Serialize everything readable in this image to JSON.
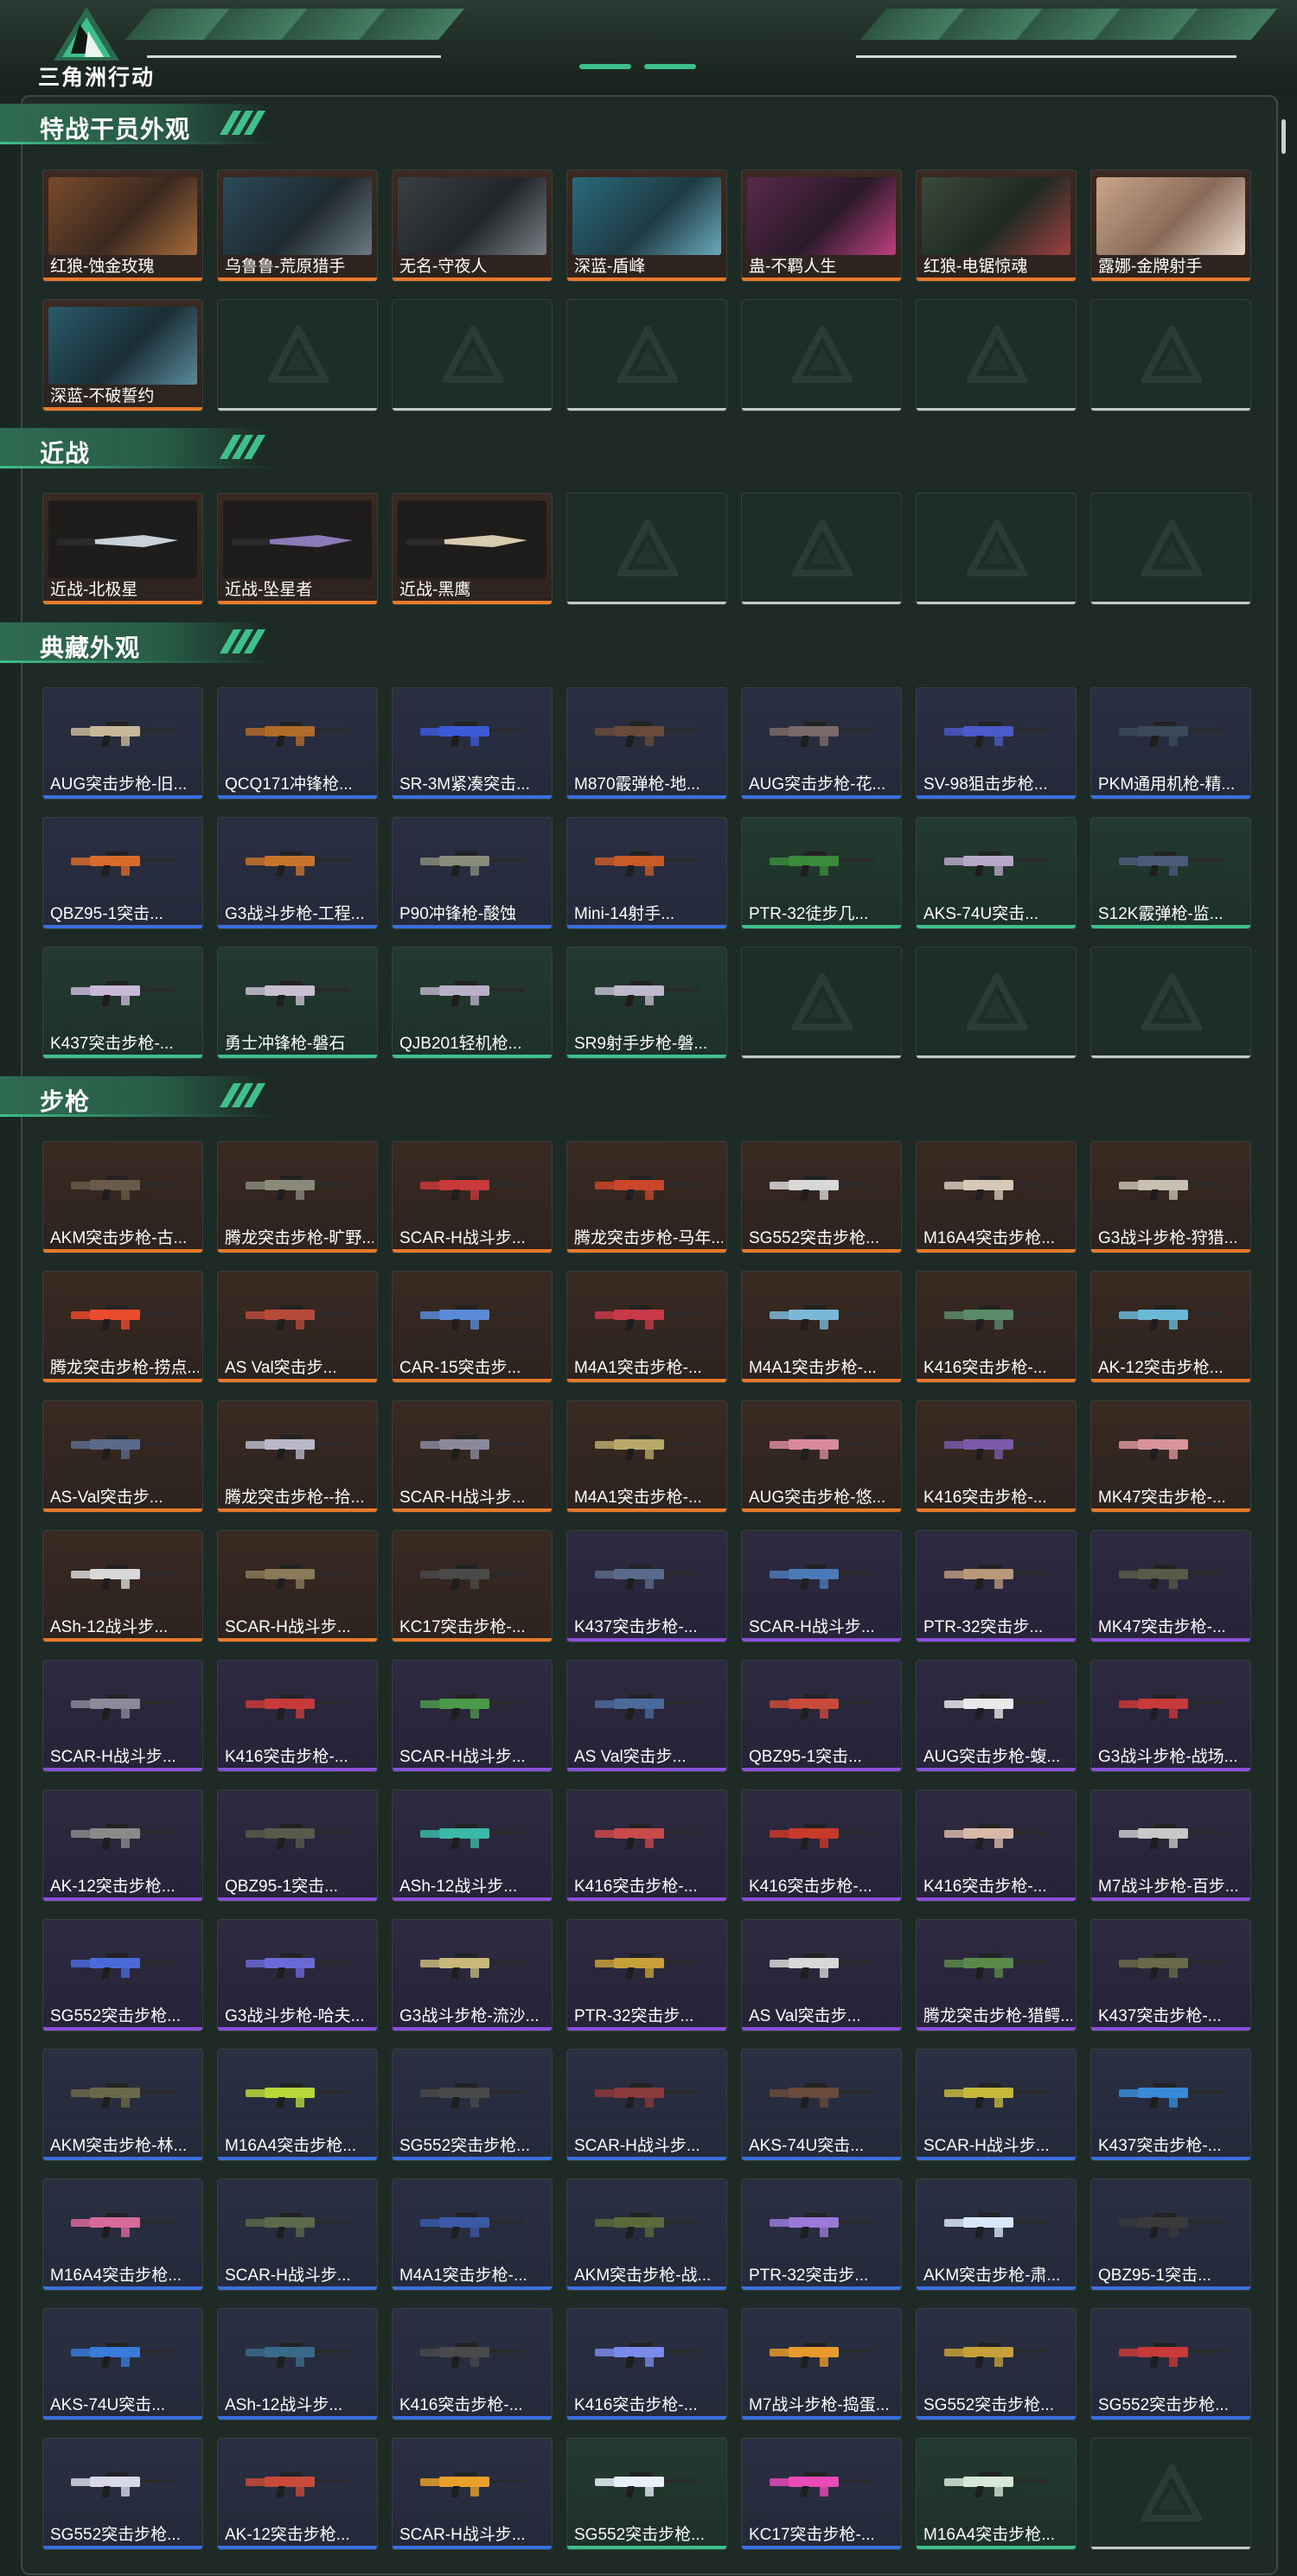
{
  "app": {
    "title": "三角洲行动"
  },
  "colors": {
    "accent": "#3fbf8c",
    "orange": "#e8782a",
    "blue": "#3a6fe0",
    "purple": "#8a4fd8",
    "green": "#3fbf8c"
  },
  "sections": [
    {
      "title": "特战干员外观",
      "kind": "operator",
      "items": [
        {
          "label": "红狼-蚀金玫瑰",
          "rarity": "orange"
        },
        {
          "label": "乌鲁鲁-荒原猎手",
          "rarity": "orange"
        },
        {
          "label": "无名-守夜人",
          "rarity": "orange"
        },
        {
          "label": "深蓝-盾峰",
          "rarity": "orange"
        },
        {
          "label": "蛊-不羁人生",
          "rarity": "orange"
        },
        {
          "label": "红狼-电锯惊魂",
          "rarity": "orange"
        },
        {
          "label": "露娜-金牌射手",
          "rarity": "orange"
        },
        {
          "label": "深蓝-不破誓约",
          "rarity": "orange"
        }
      ],
      "empty_slots": 6
    },
    {
      "title": "近战",
      "kind": "melee",
      "items": [
        {
          "label": "近战-北极星",
          "rarity": "orange"
        },
        {
          "label": "近战-坠星者",
          "rarity": "orange"
        },
        {
          "label": "近战-黑鹰",
          "rarity": "orange"
        }
      ],
      "empty_slots": 4
    },
    {
      "title": "典藏外观",
      "kind": "weapon",
      "items": [
        {
          "label": "AUG突击步枪-旧...",
          "rarity": "blue",
          "gun": "#c8b89a"
        },
        {
          "label": "QCQ171冲锋枪...",
          "rarity": "blue",
          "gun": "#b06a2a"
        },
        {
          "label": "SR-3M紧凑突击...",
          "rarity": "blue",
          "gun": "#3a5ad8"
        },
        {
          "label": "M870霰弹枪-地...",
          "rarity": "blue",
          "gun": "#6a4a3a"
        },
        {
          "label": "AUG突击步枪-花...",
          "rarity": "blue",
          "gun": "#7a6a6a"
        },
        {
          "label": "SV-98狙击步枪...",
          "rarity": "blue",
          "gun": "#4a5ac8"
        },
        {
          "label": "PKM通用机枪-精...",
          "rarity": "blue",
          "gun": "#3a4a5a"
        },
        {
          "label": "QBZ95-1突击...",
          "rarity": "blue",
          "gun": "#d86a2a"
        },
        {
          "label": "G3战斗步枪-工程...",
          "rarity": "blue",
          "gun": "#c8742a"
        },
        {
          "label": "P90冲锋枪-酸蚀",
          "rarity": "blue",
          "gun": "#8a8a7a"
        },
        {
          "label": "Mini-14射手...",
          "rarity": "blue",
          "gun": "#c85a2a"
        },
        {
          "label": "PTR-32徒步几...",
          "rarity": "green",
          "gun": "#3a8a3a"
        },
        {
          "label": "AKS-74U突击...",
          "rarity": "green",
          "gun": "#b8a8c8"
        },
        {
          "label": "S12K霰弹枪-监...",
          "rarity": "green",
          "gun": "#4a5a7a"
        },
        {
          "label": "K437突击步枪-...",
          "rarity": "green",
          "gun": "#c8b8d8"
        },
        {
          "label": "勇士冲锋枪-磐石",
          "rarity": "green",
          "gun": "#c8c0d0"
        },
        {
          "label": "QJB201轻机枪...",
          "rarity": "green",
          "gun": "#b8b0c8"
        },
        {
          "label": "SR9射手步枪-磐...",
          "rarity": "green",
          "gun": "#c0b8cc"
        }
      ],
      "empty_slots": 3
    },
    {
      "title": "步枪",
      "kind": "weapon",
      "items": [
        {
          "label": "AKM突击步枪-古...",
          "rarity": "orange",
          "gun": "#6a5a4a"
        },
        {
          "label": "腾龙突击步枪-旷野...",
          "rarity": "orange",
          "gun": "#8a8a7a"
        },
        {
          "label": "SCAR-H战斗步...",
          "rarity": "orange",
          "gun": "#c83a3a"
        },
        {
          "label": "腾龙突击步枪-马年...",
          "rarity": "orange",
          "gun": "#c8462a"
        },
        {
          "label": "SG552突击步枪...",
          "rarity": "orange",
          "gun": "#d8d8d8"
        },
        {
          "label": "M16A4突击步枪...",
          "rarity": "orange",
          "gun": "#d8c8b8"
        },
        {
          "label": "G3战斗步枪-狩猎...",
          "rarity": "orange",
          "gun": "#c8c0b0"
        },
        {
          "label": "腾龙突击步枪-捞点...",
          "rarity": "orange",
          "gun": "#e84a2a"
        },
        {
          "label": "AS Val突击步...",
          "rarity": "orange",
          "gun": "#b84a3a"
        },
        {
          "label": "CAR-15突击步...",
          "rarity": "orange",
          "gun": "#5a8ad8"
        },
        {
          "label": "M4A1突击步枪-...",
          "rarity": "orange",
          "gun": "#c83a4a"
        },
        {
          "label": "M4A1突击步枪-...",
          "rarity": "orange",
          "gun": "#7ab8d8"
        },
        {
          "label": "K416突击步枪-...",
          "rarity": "orange",
          "gun": "#5a8a6a"
        },
        {
          "label": "AK-12突击步枪...",
          "rarity": "orange",
          "gun": "#6ab8d8"
        },
        {
          "label": "AS-Val突击步...",
          "rarity": "orange",
          "gun": "#5a6a8a"
        },
        {
          "label": "腾龙突击步枪--拾...",
          "rarity": "orange",
          "gun": "#b8b8c8"
        },
        {
          "label": "SCAR-H战斗步...",
          "rarity": "orange",
          "gun": "#8a8a9a"
        },
        {
          "label": "M4A1突击步枪-...",
          "rarity": "orange",
          "gun": "#b8a86a"
        },
        {
          "label": "AUG突击步枪-悠...",
          "rarity": "orange",
          "gun": "#d88a9a"
        },
        {
          "label": "K416突击步枪-...",
          "rarity": "orange",
          "gun": "#7a5aa8"
        },
        {
          "label": "MK47突击步枪-...",
          "rarity": "orange",
          "gun": "#d8949a"
        },
        {
          "label": "ASh-12战斗步...",
          "rarity": "orange",
          "gun": "#d8d8d8"
        },
        {
          "label": "SCAR-H战斗步...",
          "rarity": "orange",
          "gun": "#8a7a5a"
        },
        {
          "label": "KC17突击步枪-...",
          "rarity": "orange",
          "gun": "#4a4a4a"
        },
        {
          "label": "K437突击步枪-...",
          "rarity": "purple",
          "gun": "#5a6a8a"
        },
        {
          "label": "SCAR-H战斗步...",
          "rarity": "purple",
          "gun": "#4a7ab8"
        },
        {
          "label": "PTR-32突击步...",
          "rarity": "purple",
          "gun": "#b89a7a"
        },
        {
          "label": "MK47突击步枪-...",
          "rarity": "purple",
          "gun": "#5a5a4a"
        },
        {
          "label": "SCAR-H战斗步...",
          "rarity": "purple",
          "gun": "#8a8a9a"
        },
        {
          "label": "K416突击步枪-...",
          "rarity": "purple",
          "gun": "#c83a3a"
        },
        {
          "label": "SCAR-H战斗步...",
          "rarity": "purple",
          "gun": "#4a9a4a"
        },
        {
          "label": "AS Val突击步...",
          "rarity": "purple",
          "gun": "#4a6a9a"
        },
        {
          "label": "QBZ95-1突击...",
          "rarity": "purple",
          "gun": "#c84a3a"
        },
        {
          "label": "AUG突击步枪-蝮...",
          "rarity": "purple",
          "gun": "#e8e8e8"
        },
        {
          "label": "G3战斗步枪-战场...",
          "rarity": "purple",
          "gun": "#c83a3a"
        },
        {
          "label": "AK-12突击步枪...",
          "rarity": "purple",
          "gun": "#8a8a8a"
        },
        {
          "label": "QBZ95-1突击...",
          "rarity": "purple",
          "gun": "#5a5a4a"
        },
        {
          "label": "ASh-12战斗步...",
          "rarity": "purple",
          "gun": "#3ab8a8"
        },
        {
          "label": "K416突击步枪-...",
          "rarity": "purple",
          "gun": "#c84a4a"
        },
        {
          "label": "K416突击步枪-...",
          "rarity": "purple",
          "gun": "#c83a2a"
        },
        {
          "label": "K416突击步枪-...",
          "rarity": "purple",
          "gun": "#d8b8a8"
        },
        {
          "label": "M7战斗步枪-百步...",
          "rarity": "purple",
          "gun": "#c8c8c8"
        },
        {
          "label": "SG552突击步枪...",
          "rarity": "purple",
          "gun": "#4a6ad8"
        },
        {
          "label": "G3战斗步枪-哈夫...",
          "rarity": "purple",
          "gun": "#6a6ad8"
        },
        {
          "label": "G3战斗步枪-流沙...",
          "rarity": "purple",
          "gun": "#c8b87a"
        },
        {
          "label": "PTR-32突击步...",
          "rarity": "purple",
          "gun": "#c8a03a"
        },
        {
          "label": "AS Val突击步...",
          "rarity": "purple",
          "gun": "#d8d8d8"
        },
        {
          "label": "腾龙突击步枪-猎鳄...",
          "rarity": "purple",
          "gun": "#5a8a4a"
        },
        {
          "label": "K437突击步枪-...",
          "rarity": "purple",
          "gun": "#6a6a4a"
        },
        {
          "label": "AKM突击步枪-林...",
          "rarity": "blue",
          "gun": "#6a6a4a"
        },
        {
          "label": "M16A4突击步枪...",
          "rarity": "blue",
          "gun": "#b8d83a"
        },
        {
          "label": "SG552突击步枪...",
          "rarity": "blue",
          "gun": "#4a4a4a"
        },
        {
          "label": "SCAR-H战斗步...",
          "rarity": "blue",
          "gun": "#8a3a3a"
        },
        {
          "label": "AKS-74U突击...",
          "rarity": "blue",
          "gun": "#6a4a3a"
        },
        {
          "label": "SCAR-H战斗步...",
          "rarity": "blue",
          "gun": "#c8b83a"
        },
        {
          "label": "K437突击步枪-...",
          "rarity": "blue",
          "gun": "#3a8ad8"
        },
        {
          "label": "M16A4突击步枪...",
          "rarity": "blue",
          "gun": "#d86a9a"
        },
        {
          "label": "SCAR-H战斗步...",
          "rarity": "blue",
          "gun": "#5a6a4a"
        },
        {
          "label": "M4A1突击步枪-...",
          "rarity": "blue",
          "gun": "#3a5aa8"
        },
        {
          "label": "AKM突击步枪-战...",
          "rarity": "blue",
          "gun": "#5a6a3a"
        },
        {
          "label": "PTR-32突击步...",
          "rarity": "blue",
          "gun": "#9a7ad8"
        },
        {
          "label": "AKM突击步枪-肃...",
          "rarity": "blue",
          "gun": "#d8e8f8"
        },
        {
          "label": "QBZ95-1突击...",
          "rarity": "blue",
          "gun": "#3a3a3a"
        },
        {
          "label": "AKS-74U突击...",
          "rarity": "blue",
          "gun": "#3a7ad8"
        },
        {
          "label": "ASh-12战斗步...",
          "rarity": "blue",
          "gun": "#3a6a8a"
        },
        {
          "label": "K416突击步枪-...",
          "rarity": "blue",
          "gun": "#4a4a4a"
        },
        {
          "label": "K416突击步枪-...",
          "rarity": "blue",
          "gun": "#7a8ae8"
        },
        {
          "label": "M7战斗步枪-捣蛋...",
          "rarity": "blue",
          "gun": "#e89a2a"
        },
        {
          "label": "SG552突击步枪...",
          "rarity": "blue",
          "gun": "#c8a03a"
        },
        {
          "label": "SG552突击步枪...",
          "rarity": "blue",
          "gun": "#c83a3a"
        },
        {
          "label": "SG552突击步枪...",
          "rarity": "blue",
          "gun": "#d8d8e8"
        },
        {
          "label": "AK-12突击步枪...",
          "rarity": "blue",
          "gun": "#c84a3a"
        },
        {
          "label": "SCAR-H战斗步...",
          "rarity": "blue",
          "gun": "#e8a02a"
        },
        {
          "label": "SG552突击步枪...",
          "rarity": "green",
          "gun": "#e8f0f8"
        },
        {
          "label": "KC17突击步枪-...",
          "rarity": "blue",
          "gun": "#e84ab8"
        },
        {
          "label": "M16A4突击步枪...",
          "rarity": "green",
          "gun": "#d8e8d8"
        }
      ],
      "empty_slots": 1
    }
  ]
}
